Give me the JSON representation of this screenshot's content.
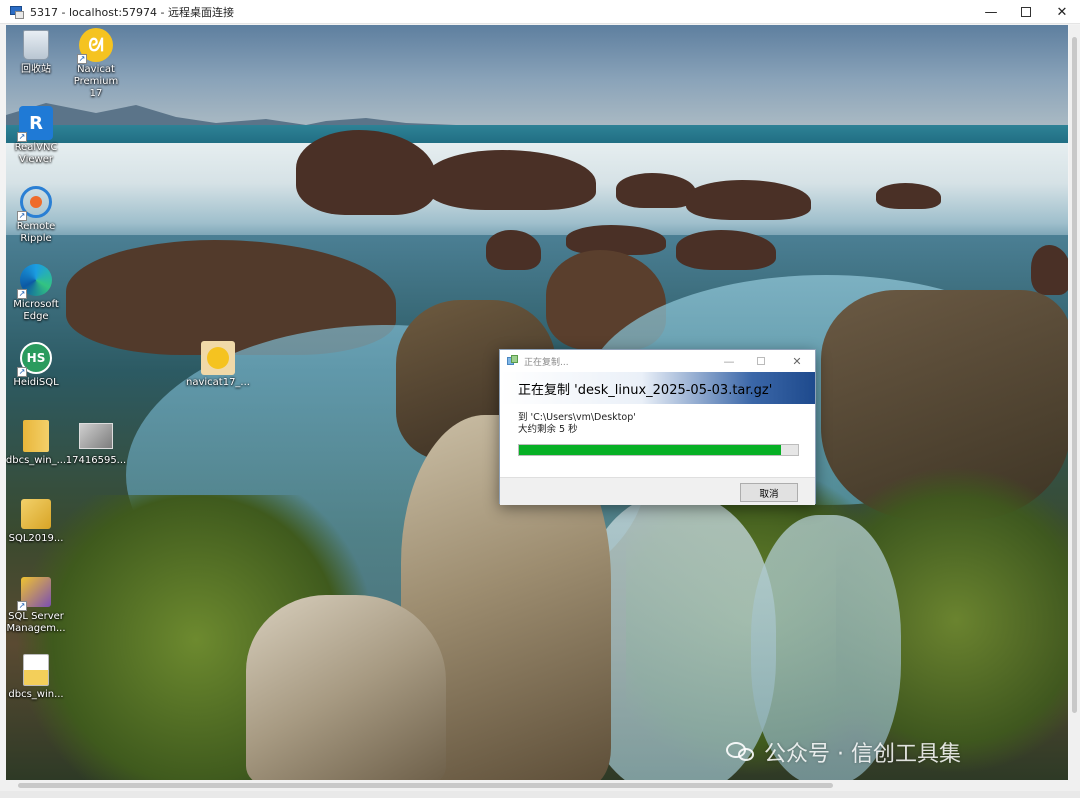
{
  "window": {
    "title": "5317 - localhost:57974 - 远程桌面连接",
    "minimize_label": "—",
    "close_label": "✕"
  },
  "desktop_icons": [
    {
      "label": "回收站",
      "icon": "recycle-bin-icon"
    },
    {
      "label": "Navicat Premium 17",
      "icon": "navicat-icon"
    },
    {
      "label": "RealVNC Viewer",
      "icon": "realvnc-icon"
    },
    {
      "label": "Remote Ripple",
      "icon": "remote-ripple-icon"
    },
    {
      "label": "Microsoft Edge",
      "icon": "edge-icon"
    },
    {
      "label": "HeidiSQL",
      "icon": "heidisql-icon"
    },
    {
      "label": "navicat17_...",
      "icon": "navicat-installer-icon"
    },
    {
      "label": "dbcs_win_...",
      "icon": "zip-archive-icon"
    },
    {
      "label": "17416595...",
      "icon": "image-file-icon"
    },
    {
      "label": "SQL2019...",
      "icon": "sql-server-setup-icon"
    },
    {
      "label": "SQL Server Managem...",
      "icon": "ssms-icon"
    },
    {
      "label": "dbcs_win...",
      "icon": "file-icon"
    }
  ],
  "copy_dialog": {
    "title": "正在复制...",
    "heading": "正在复制 'desk_linux_2025-05-03.tar.gz'",
    "destination": "到 'C:\\Users\\vm\\Desktop'",
    "time_remaining": "大约剩余 5 秒",
    "progress": 0.94,
    "progress_color": "#06b025",
    "cancel_label": "取消"
  },
  "watermark": {
    "text": "公众号 · 信创工具集"
  }
}
